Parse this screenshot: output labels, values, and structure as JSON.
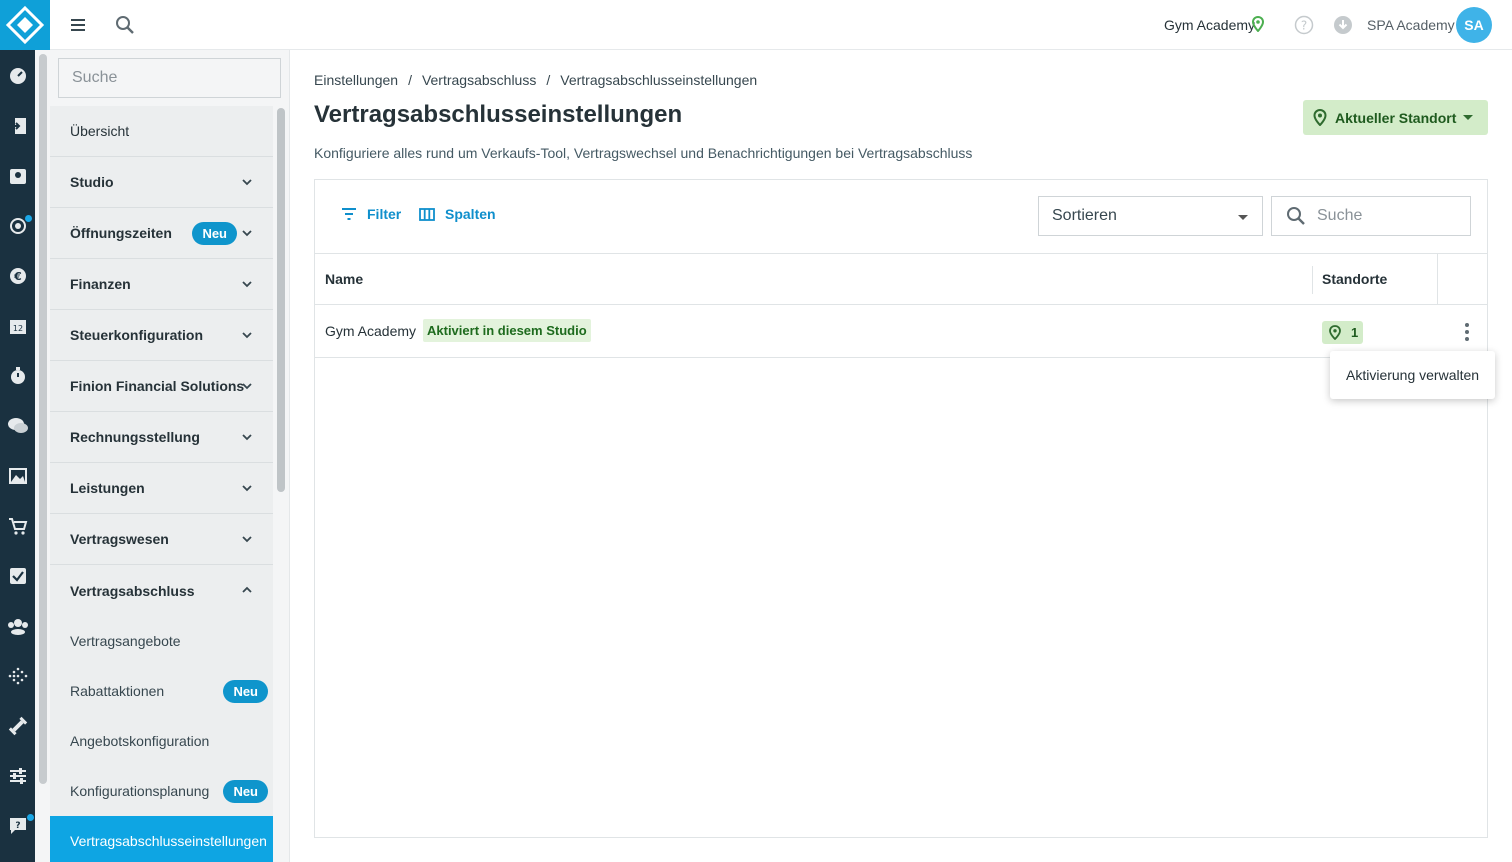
{
  "topbar": {
    "studio_name": "Gym Academy",
    "account_name": "SPA Academy",
    "avatar_initials": "SA"
  },
  "rail_icons": [
    "dashboard-icon",
    "checkin-icon",
    "contacts-icon",
    "target-icon",
    "euro-icon",
    "calendar-icon",
    "timer-icon",
    "chat-icon",
    "image-icon",
    "cart-icon",
    "tasks-icon",
    "groups-icon",
    "activity-icon",
    "dumbbell-icon",
    "settings-sliders-icon",
    "help-chat-icon"
  ],
  "subnav": {
    "search_placeholder": "Suche",
    "items": [
      {
        "label": "Übersicht"
      },
      {
        "label": "Studio"
      },
      {
        "label": "Öffnungszeiten",
        "badge": "Neu"
      },
      {
        "label": "Finanzen"
      },
      {
        "label": "Steuerkonfiguration"
      },
      {
        "label": "Finion Financial Solutions"
      },
      {
        "label": "Rechnungsstellung"
      },
      {
        "label": "Leistungen"
      },
      {
        "label": "Vertragswesen"
      },
      {
        "label": "Vertragsabschluss"
      }
    ],
    "subitems": [
      {
        "label": "Vertragsangebote"
      },
      {
        "label": "Rabattaktionen",
        "badge": "Neu"
      },
      {
        "label": "Angebotskonfiguration"
      },
      {
        "label": "Konfigurationsplanung",
        "badge": "Neu"
      },
      {
        "label": "Vertragsabschlusseinstellungen"
      }
    ]
  },
  "breadcrumb": [
    "Einstellungen",
    "Vertragsabschluss",
    "Vertragsabschlusseinstellungen"
  ],
  "page": {
    "title": "Vertragsabschlusseinstellungen",
    "description": "Konfiguriere alles rund um Verkaufs-Tool, Vertragswechsel und Benachrichtigungen bei Vertragsabschluss",
    "location_button": "Aktueller Standort"
  },
  "toolbar": {
    "filter_label": "Filter",
    "columns_label": "Spalten",
    "sort_placeholder": "Sortieren",
    "search_placeholder": "Suche"
  },
  "table": {
    "columns": [
      "Name",
      "Standorte"
    ],
    "rows": [
      {
        "name": "Gym Academy",
        "tag": "Aktiviert in diesem Studio",
        "locations": "1"
      }
    ]
  },
  "context_menu": {
    "items": [
      "Aktivierung verwalten"
    ]
  },
  "colors": {
    "rail": "#1a3140",
    "accent": "#0ea5e3",
    "success_bg": "#d3ecc9"
  }
}
